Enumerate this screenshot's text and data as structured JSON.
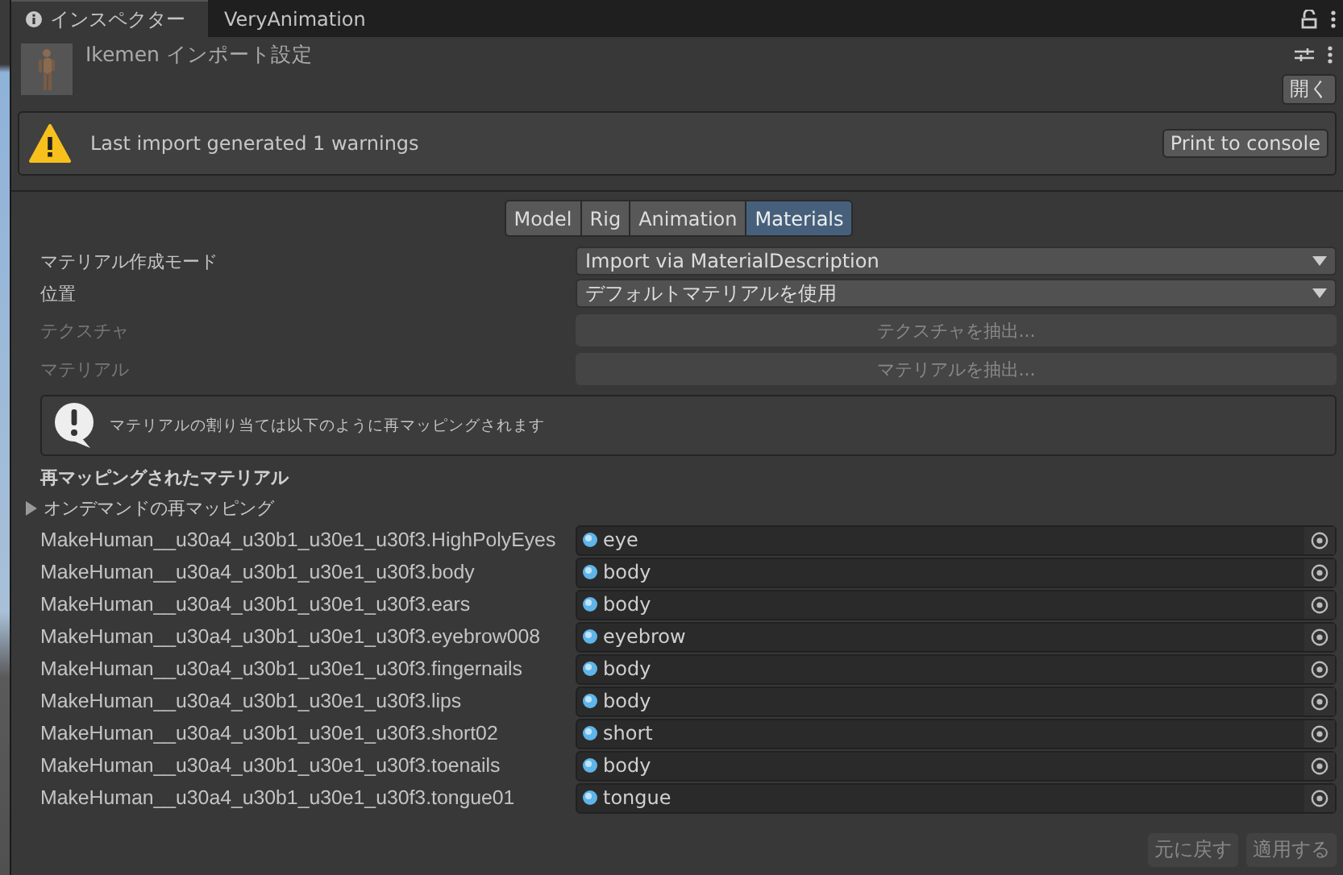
{
  "window_tabs": [
    {
      "label": "インスペクター",
      "selected": true,
      "kind": "info"
    },
    {
      "label": "VeryAnimation",
      "selected": false,
      "kind": "plain"
    }
  ],
  "asset": {
    "kind": "picture",
    "title": "Ikemen インポート設定",
    "open_button": "開く"
  },
  "warning": {
    "message": "Last import generated 1 warnings",
    "button": "Print to console"
  },
  "import_tabs": [
    {
      "label": "Model",
      "selected": false
    },
    {
      "label": "Rig",
      "selected": false
    },
    {
      "label": "Animation",
      "selected": false
    },
    {
      "label": "Materials",
      "selected": true
    }
  ],
  "settings": [
    {
      "label": "マテリアル作成モード",
      "kind": "dropdown",
      "value": "Import via MaterialDescription",
      "disabled": false
    },
    {
      "label": "位置",
      "kind": "dropdown",
      "value": "デフォルトマテリアルを使用",
      "disabled": false
    },
    {
      "label": "テクスチャ",
      "kind": "button",
      "value": "テクスチャを抽出...",
      "disabled": true
    },
    {
      "label": "マテリアル",
      "kind": "button",
      "value": "マテリアルを抽出...",
      "disabled": true
    }
  ],
  "info": {
    "message": "マテリアルの割り当ては以下のように再マッピングされます"
  },
  "remapped": {
    "title": "再マッピングされたマテリアル",
    "foldout": {
      "label": "オンデマンドの再マッピング",
      "expanded": false
    },
    "rows": [
      {
        "name": "MakeHuman__u30a4_u30b1_u30e1_u30f3.HighPolyEyes",
        "material": "eye"
      },
      {
        "name": "MakeHuman__u30a4_u30b1_u30e1_u30f3.body",
        "material": "body"
      },
      {
        "name": "MakeHuman__u30a4_u30b1_u30e1_u30f3.ears",
        "material": "body"
      },
      {
        "name": "MakeHuman__u30a4_u30b1_u30e1_u30f3.eyebrow008",
        "material": "eyebrow"
      },
      {
        "name": "MakeHuman__u30a4_u30b1_u30e1_u30f3.fingernails",
        "material": "body"
      },
      {
        "name": "MakeHuman__u30a4_u30b1_u30e1_u30f3.lips",
        "material": "body"
      },
      {
        "name": "MakeHuman__u30a4_u30b1_u30e1_u30f3.short02",
        "material": "short"
      },
      {
        "name": "MakeHuman__u30a4_u30b1_u30e1_u30f3.toenails",
        "material": "body"
      },
      {
        "name": "MakeHuman__u30a4_u30b1_u30e1_u30f3.tongue01",
        "material": "tongue"
      }
    ]
  },
  "footer_buttons": [
    {
      "label": "元に戻す",
      "disabled": true
    },
    {
      "label": "適用する",
      "disabled": true
    }
  ]
}
